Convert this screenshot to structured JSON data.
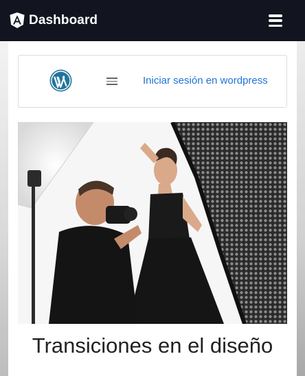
{
  "header": {
    "title": "Dashboard",
    "brand_icon": "angular-shield-icon",
    "menu_icon": "hamburger-menu-icon",
    "bg_color": "#12141f"
  },
  "wp_card": {
    "logo_icon": "wordpress-logo-icon",
    "menu_icon": "hamburger-menu-icon",
    "login_link": "Iniciar sesión en wordpress",
    "link_color": "#1e73d9"
  },
  "post": {
    "image_alt": "Photographer shooting a model in a studio",
    "title": "Transiciones en el diseño"
  }
}
